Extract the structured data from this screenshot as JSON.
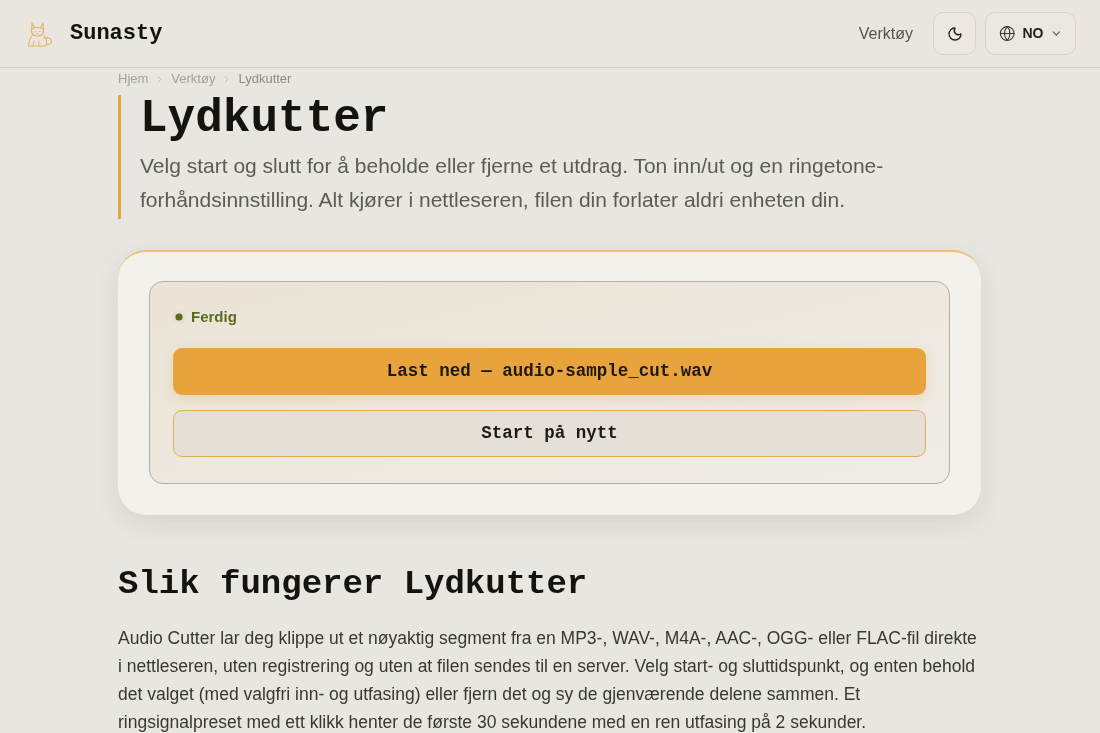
{
  "header": {
    "brand": "Sunasty",
    "nav_link": "Verktøy",
    "language": "NO"
  },
  "breadcrumb": [
    {
      "label": "Hjem",
      "current": false
    },
    {
      "label": "Verktøy",
      "current": false
    },
    {
      "label": "Lydkutter",
      "current": true
    }
  ],
  "page": {
    "title": "Lydkutter",
    "description": "Velg start og slutt for å beholde eller fjerne et utdrag. Ton inn/ut og en ringetone-forhåndsinnstilling. Alt kjører i nettleseren, filen din forlater aldri enheten din."
  },
  "result_panel": {
    "status": "Ferdig",
    "download_button": "Last ned — audio-sample_cut.wav",
    "restart_button": "Start på nytt"
  },
  "section": {
    "heading": "Slik fungerer Lydkutter",
    "body": "Audio Cutter lar deg klippe ut et nøyaktig segment fra en MP3-, WAV-, M4A-, AAC-, OGG- eller FLAC-fil direkte i nettleseren, uten registrering og uten at filen sendes til en server. Velg start- og sluttidspunkt, og enten behold det valget (med valgfri inn- og utfasing) eller fjern det og sy de gjenværende delene sammen. Et ringsignalpreset med ett klikk henter de første 30 sekundene med en ren utfasing på 2 sekunder."
  }
}
